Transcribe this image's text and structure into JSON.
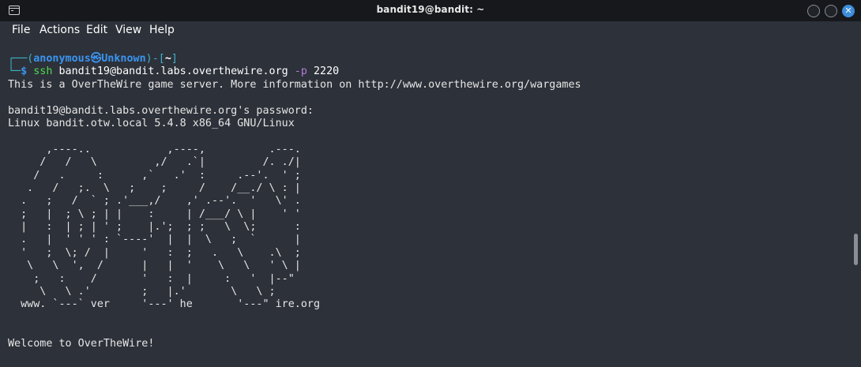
{
  "window": {
    "title": "bandit19@bandit: ~",
    "close_glyph": "✕"
  },
  "menu": {
    "items": [
      "File",
      "Actions",
      "Edit",
      "View",
      "Help"
    ]
  },
  "prompt": {
    "corner_top": "┌──",
    "user_open": "(",
    "user": "anonymous",
    "at_symbol": "㉿",
    "host": "Unknown",
    "user_close": ")",
    "sep": "-[",
    "dir": "~",
    "dir_close": "]",
    "corner_bottom": "└─",
    "dollar": "$ ",
    "cmd_name": "ssh",
    "cmd_args": " bandit19@bandit.labs.overthewire.org ",
    "cmd_flag": "-p",
    "cmd_port": " 2220"
  },
  "output": {
    "lines": [
      "This is a OverTheWire game server. More information on http://www.overthewire.org/wargames",
      "",
      "bandit19@bandit.labs.overthewire.org's password:",
      "Linux bandit.otw.local 5.4.8 x86_64 GNU/Linux",
      "",
      "      ,----..            ,----,          .---.",
      "     /   /   \\         ,/   .`|         /. ./|",
      "    /   .     :      ,`   .'  :     .--'.  ' ;",
      "   .   /   ;.  \\   ;    ;     /    /__./ \\ : |",
      "  .   ;   /  ` ; .'___,/    ,' .--'.  '   \\' .",
      "  ;   |  ; \\ ; | |    :     | /___/ \\ |    ' '",
      "  |   :  | ; | ' ;    |.';  ; ;   \\  \\;      :",
      "  .   |  ' ' ' : `----'  |  |  \\   ;  `      |",
      "  '   ;  \\; /  |     '   :  ;   .   \\    .\\  ;",
      "   \\   \\  ',  /      |   |  '    \\   \\   ' \\ |",
      "    ;   :    /       '   :  |     :   '  |--\"",
      "     \\   \\ .'        ;   |.'       \\   \\ ;",
      "  www. `---` ver     '---' he       '---\" ire.org",
      "",
      "",
      "Welcome to OverTheWire!"
    ]
  },
  "colors": {
    "terminal_bg": "#2d3139",
    "titlebar_bg": "#16181c",
    "prompt_frame": "#3fb1c7",
    "prompt_user": "#3a94f0",
    "command": "#4fdc50",
    "flag": "#b07dd6",
    "close_button": "#3d8dd9"
  }
}
